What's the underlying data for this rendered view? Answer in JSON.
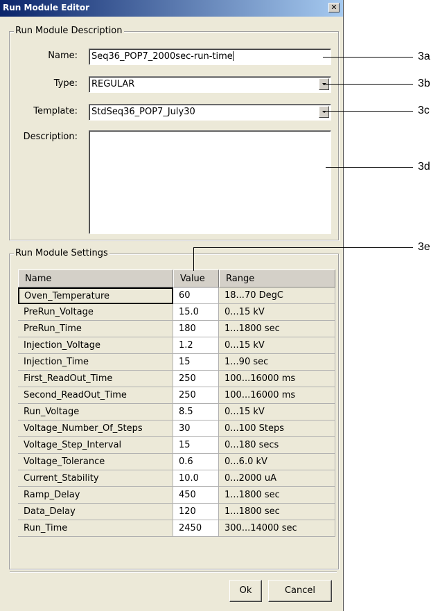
{
  "window": {
    "title": "Run Module Editor",
    "close_glyph": "✕"
  },
  "description_group": {
    "label": "Run Module Description",
    "name_label": "Name:",
    "name_value": "Seq36_POP7_2000sec-run-time",
    "type_label": "Type:",
    "type_value": "REGULAR",
    "template_label": "Template:",
    "template_value": "StdSeq36_POP7_July30",
    "description_label": "Description:",
    "description_value": ""
  },
  "settings_group": {
    "label": "Run Module Settings",
    "columns": [
      "Name",
      "Value",
      "Range"
    ],
    "rows": [
      {
        "name": "Oven_Temperature",
        "value": "60",
        "range": "18...70 DegC"
      },
      {
        "name": "PreRun_Voltage",
        "value": "15.0",
        "range": "0...15 kV"
      },
      {
        "name": "PreRun_Time",
        "value": "180",
        "range": "1...1800 sec"
      },
      {
        "name": "Injection_Voltage",
        "value": "1.2",
        "range": "0...15 kV"
      },
      {
        "name": "Injection_Time",
        "value": "15",
        "range": "1...90 sec"
      },
      {
        "name": "First_ReadOut_Time",
        "value": "250",
        "range": "100...16000 ms"
      },
      {
        "name": "Second_ReadOut_Time",
        "value": "250",
        "range": "100...16000 ms"
      },
      {
        "name": "Run_Voltage",
        "value": "8.5",
        "range": "0...15 kV"
      },
      {
        "name": "Voltage_Number_Of_Steps",
        "value": "30",
        "range": "0...100 Steps"
      },
      {
        "name": "Voltage_Step_Interval",
        "value": "15",
        "range": "0...180 secs"
      },
      {
        "name": "Voltage_Tolerance",
        "value": "0.6",
        "range": "0...6.0 kV"
      },
      {
        "name": "Current_Stability",
        "value": "10.0",
        "range": "0...2000 uA"
      },
      {
        "name": "Ramp_Delay",
        "value": "450",
        "range": "1...1800 sec"
      },
      {
        "name": "Data_Delay",
        "value": "120",
        "range": "1...1800 sec"
      },
      {
        "name": "Run_Time",
        "value": "2450",
        "range": "300...14000 sec"
      }
    ]
  },
  "buttons": {
    "ok": "Ok",
    "cancel": "Cancel"
  },
  "callouts": [
    "3a",
    "3b",
    "3c",
    "3d",
    "3e"
  ],
  "colors": {
    "titlebar_start": "#0a246a",
    "titlebar_end": "#a6caf0",
    "dialog_bg": "#ece9d8"
  }
}
